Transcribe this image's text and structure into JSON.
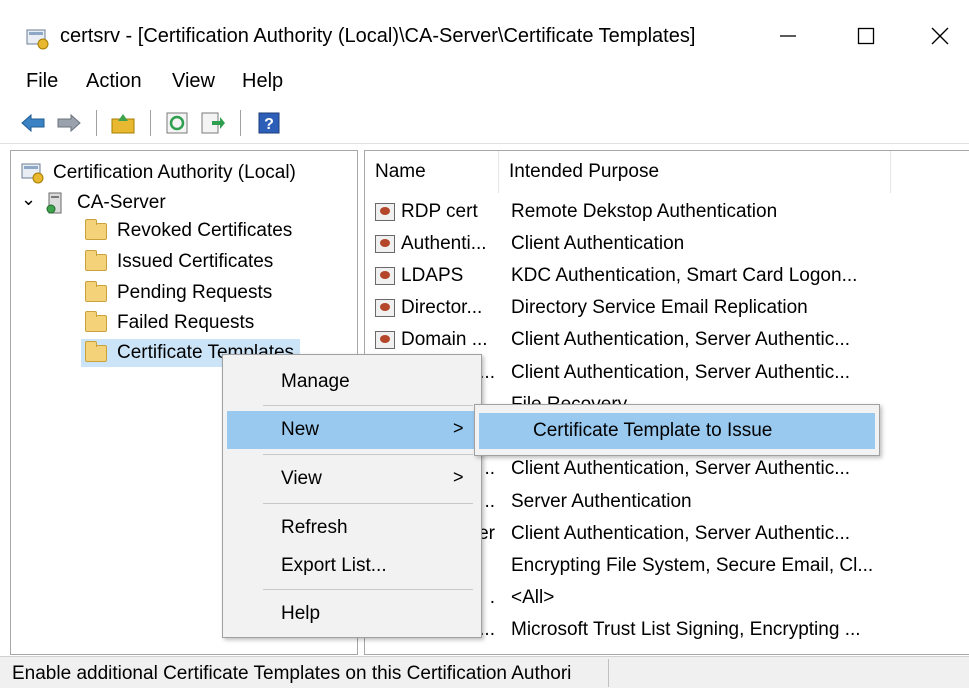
{
  "window": {
    "title": "certsrv - [Certification Authority (Local)\\CA-Server\\Certificate Templates]",
    "minimize_glyph": "—",
    "maximize_glyph": "☐",
    "close_glyph": "✕"
  },
  "menubar": {
    "file": "File",
    "action": "Action",
    "view": "View",
    "help": "Help"
  },
  "toolbar": {
    "icons": [
      "back-arrow-icon",
      "forward-arrow-icon",
      "up-folder-icon",
      "refresh-icon",
      "export-list-icon",
      "help-icon"
    ],
    "colors": {
      "arrow": "#3b82c4",
      "folder": "#e8b830",
      "help": "#2d5fb8"
    }
  },
  "tree": {
    "root": "Certification Authority (Local)",
    "server": "CA-Server",
    "expand_glyph": "⌄",
    "items": [
      "Revoked Certificates",
      "Issued Certificates",
      "Pending Requests",
      "Failed Requests",
      "Certificate Templates"
    ]
  },
  "list": {
    "columns": [
      "Name",
      "Intended Purpose"
    ],
    "rows": [
      {
        "name": "RDP cert",
        "purpose": "Remote Dekstop Authentication"
      },
      {
        "name": "Authenti...",
        "purpose": "Client Authentication"
      },
      {
        "name": "LDAPS",
        "purpose": "KDC Authentication, Smart Card Logon..."
      },
      {
        "name": "Director...",
        "purpose": "Directory Service Email Replication"
      },
      {
        "name": "Domain ...",
        "purpose": "Client Authentication, Server Authentic..."
      },
      {
        "name": "...",
        "purpose": "Client Authentication, Server Authentic..."
      },
      {
        "name": "",
        "purpose": "File Recovery"
      },
      {
        "name": "",
        "purpose": ""
      },
      {
        "name": "..",
        "purpose": "Client Authentication, Server Authentic..."
      },
      {
        "name": "..",
        "purpose": "Server Authentication"
      },
      {
        "name": "er",
        "purpose": "Client Authentication, Server Authentic..."
      },
      {
        "name": "",
        "purpose": "Encrypting File System, Secure Email, Cl..."
      },
      {
        "name": ".",
        "purpose": "<All>"
      },
      {
        "name": "...",
        "purpose": "Microsoft Trust List Signing, Encrypting ..."
      }
    ]
  },
  "context_menu": {
    "manage": "Manage",
    "new": "New",
    "view": "View",
    "refresh": "Refresh",
    "export_list": "Export List...",
    "help": "Help",
    "submenu_arrow": ">"
  },
  "submenu": {
    "item": "Certificate Template to Issue"
  },
  "status": {
    "text": "Enable additional Certificate Templates on this Certification Authori"
  }
}
